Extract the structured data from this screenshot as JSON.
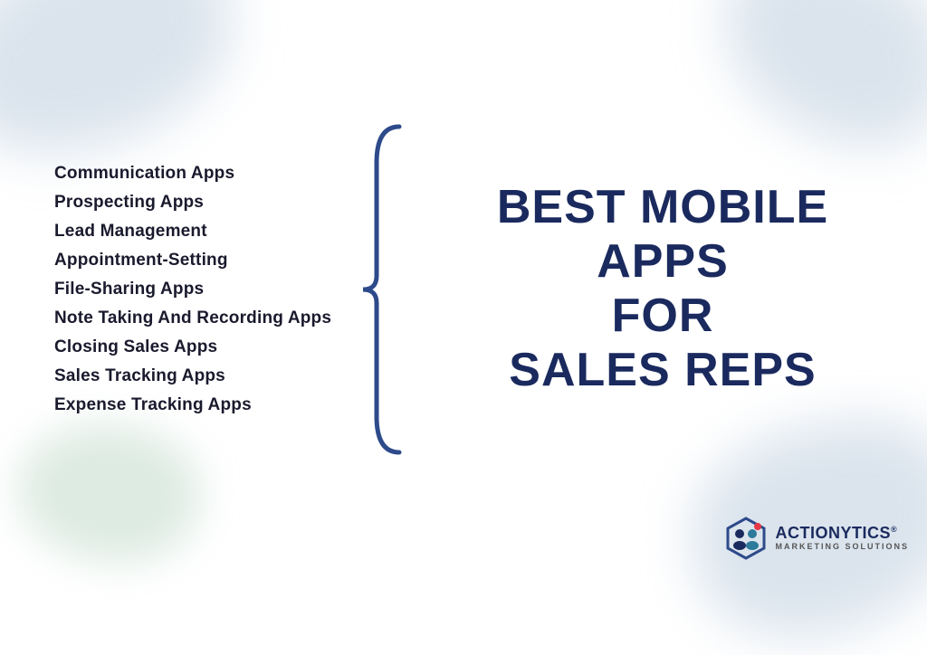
{
  "background": {
    "color": "#ffffff"
  },
  "list": {
    "items": [
      {
        "id": 1,
        "label": "Communication Apps"
      },
      {
        "id": 2,
        "label": "Prospecting Apps"
      },
      {
        "id": 3,
        "label": "Lead Management"
      },
      {
        "id": 4,
        "label": "Appointment-Setting"
      },
      {
        "id": 5,
        "label": "File-Sharing Apps"
      },
      {
        "id": 6,
        "label": "Note Taking And Recording Apps"
      },
      {
        "id": 7,
        "label": "Closing Sales Apps"
      },
      {
        "id": 8,
        "label": "Sales Tracking Apps"
      },
      {
        "id": 9,
        "label": "Expense Tracking Apps"
      }
    ]
  },
  "title": {
    "line1": "BEST MOBILE APPS",
    "line2": "FOR",
    "line3": "SALES REPS"
  },
  "logo": {
    "brand": "ACTIONYTICS",
    "trademark": "®",
    "subtitle": "MARKETING SOLUTIONS"
  },
  "colors": {
    "text_dark": "#1a1a2e",
    "title_blue": "#1a2a5e",
    "bracket_blue": "#2d4a8a",
    "blob_blue": "rgba(176, 196, 215, 0.45)",
    "blob_green": "rgba(144, 190, 160, 0.3)"
  }
}
